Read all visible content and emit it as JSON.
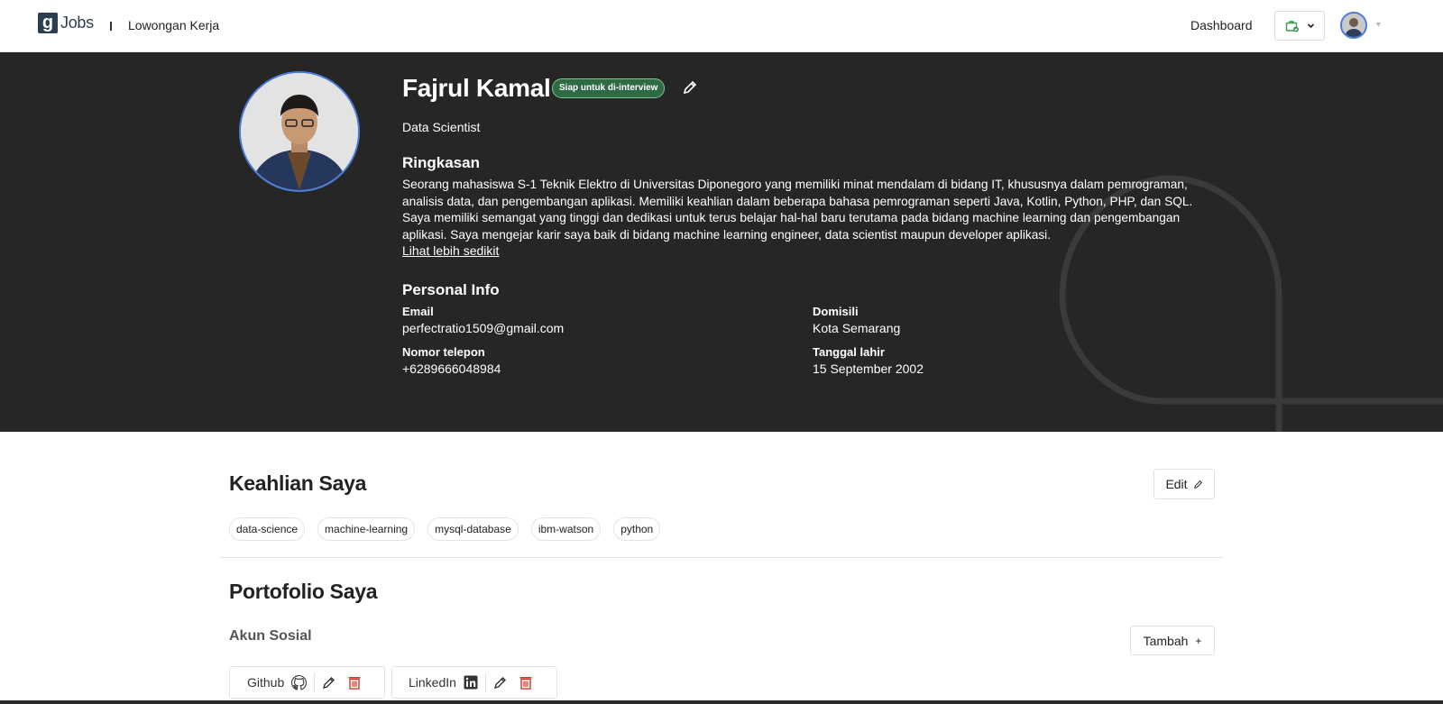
{
  "navbar": {
    "logo_mark": "g",
    "logo_text": "Jobs",
    "jobs_link": "Lowongan Kerja",
    "dashboard_link": "Dashboard"
  },
  "profile": {
    "name": "Fajrul Kamal",
    "badge": "Siap untuk di-interview",
    "role": "Data Scientist",
    "summary_heading": "Ringkasan",
    "summary": "Seorang mahasiswa S-1 Teknik Elektro di Universitas Diponegoro yang memiliki minat mendalam di bidang IT, khususnya dalam pemrograman, analisis data, dan pengembangan aplikasi. Memiliki keahlian dalam beberapa bahasa pemrograman seperti Java, Kotlin, Python, PHP, dan SQL. Saya memiliki semangat yang tinggi dan dedikasi untuk terus belajar hal-hal baru terutama pada bidang machine learning dan pengembangan aplikasi. Saya mengejar karir saya baik di bidang machine learning engineer, data scientist maupun developer aplikasi.",
    "see_less": "Lihat lebih sedikit",
    "personal_heading": "Personal Info",
    "info": {
      "email_label": "Email",
      "email_value": "perfectratio1509@gmail.com",
      "domicile_label": "Domisili",
      "domicile_value": "Kota Semarang",
      "phone_label": "Nomor telepon",
      "phone_value": "+6289666048984",
      "birth_label": "Tanggal lahir",
      "birth_value": "15 September 2002"
    }
  },
  "skills": {
    "heading": "Keahlian Saya",
    "edit_label": "Edit",
    "items": [
      "data-science",
      "machine-learning",
      "mysql-database",
      "ibm-watson",
      "python"
    ]
  },
  "portfolio": {
    "heading": "Portofolio Saya",
    "social_heading": "Akun Sosial",
    "add_label": "Tambah",
    "accounts": [
      {
        "name": "Github",
        "icon": "github-icon"
      },
      {
        "name": "LinkedIn",
        "icon": "linkedin-icon"
      }
    ]
  },
  "colors": {
    "hero_bg": "#262626",
    "badge_bg": "#2e6b44",
    "delete_red": "#d9362b",
    "avatar_ring": "#4a7bd6"
  }
}
